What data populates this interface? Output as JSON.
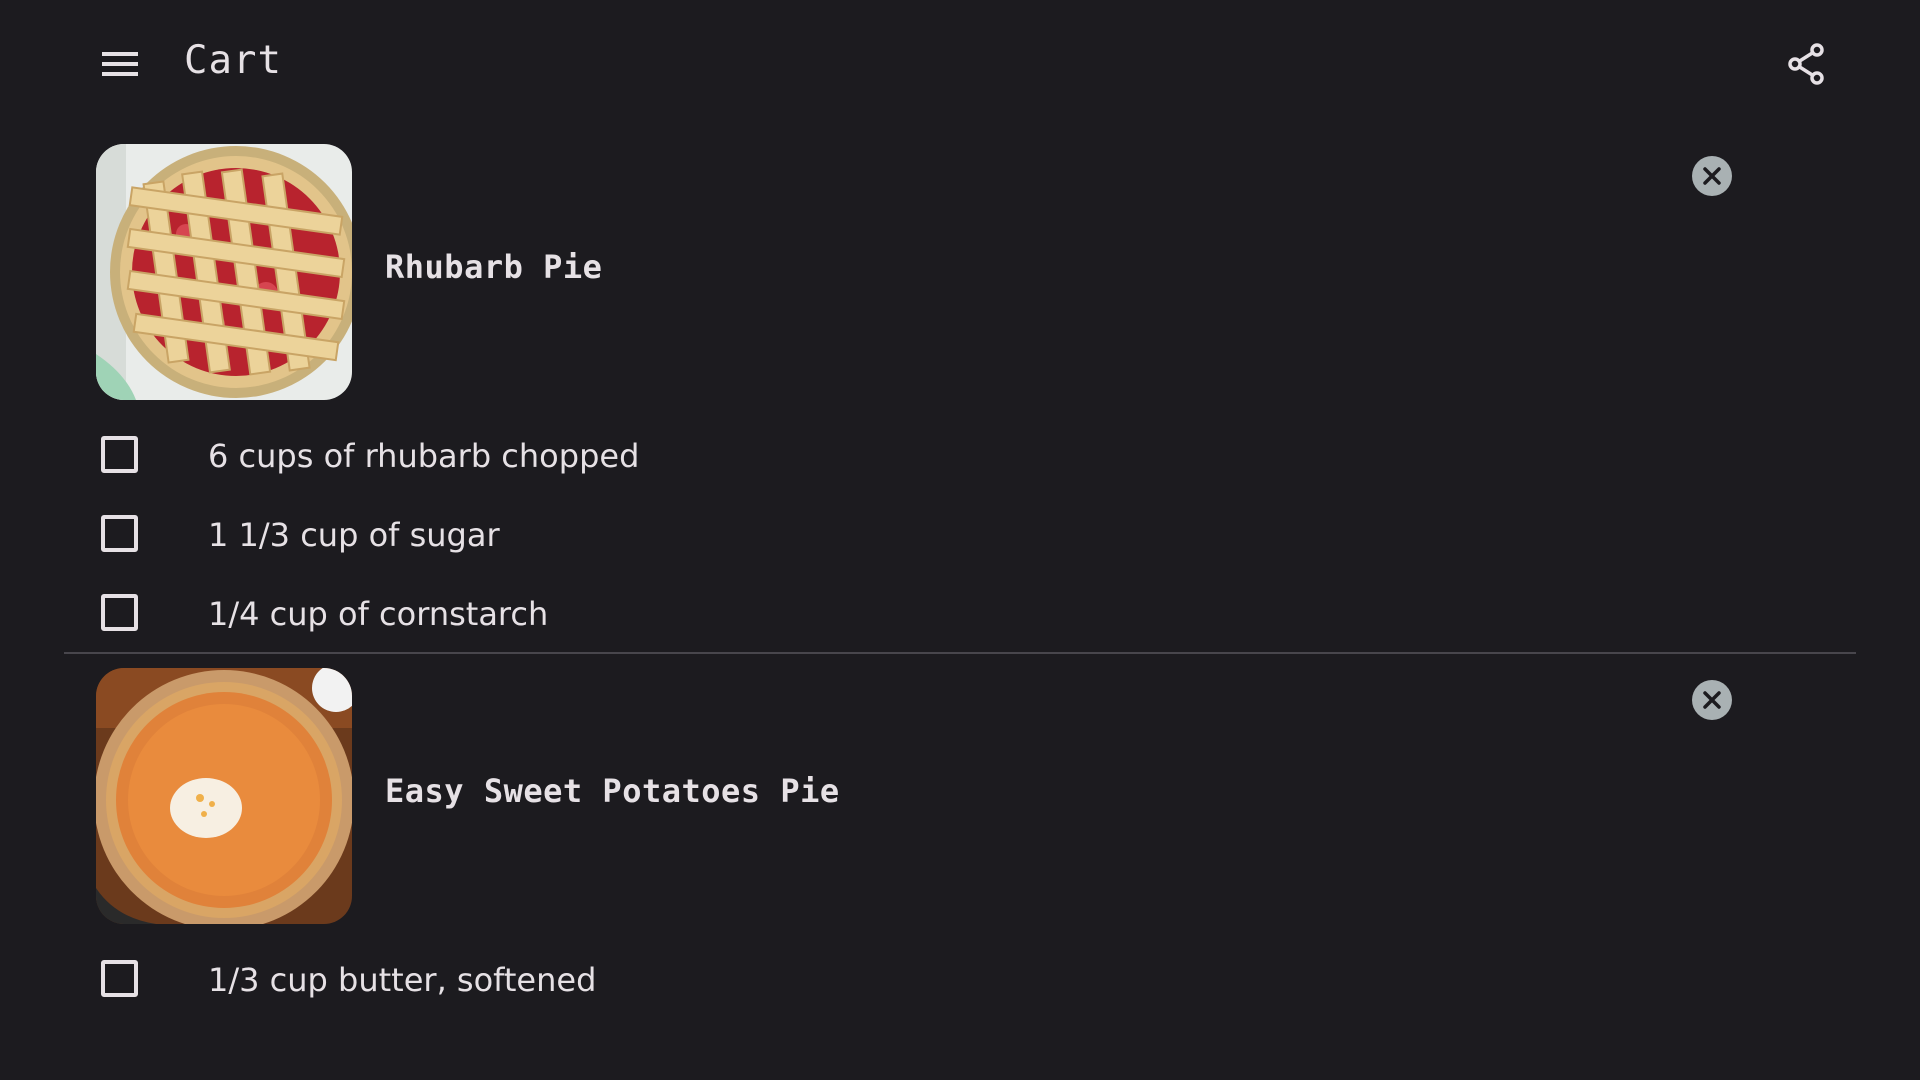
{
  "header": {
    "title": "Cart",
    "menu_icon": "hamburger-menu-icon",
    "share_icon": "share-icon"
  },
  "recipes": [
    {
      "title": "Rhubarb Pie",
      "remove_icon": "close-circle-icon",
      "ingredients": [
        "6 cups of rhubarb chopped",
        "1 1/3 cup of sugar",
        "1/4 cup of cornstarch"
      ]
    },
    {
      "title": "Easy Sweet Potatoes Pie",
      "remove_icon": "close-circle-icon",
      "ingredients": [
        "1/3 cup butter, softened"
      ]
    }
  ],
  "colors": {
    "background": "#1c1b1f",
    "text": "#e6e1e5",
    "remove_button": "#a9b1b3",
    "divider": "#48464c"
  }
}
